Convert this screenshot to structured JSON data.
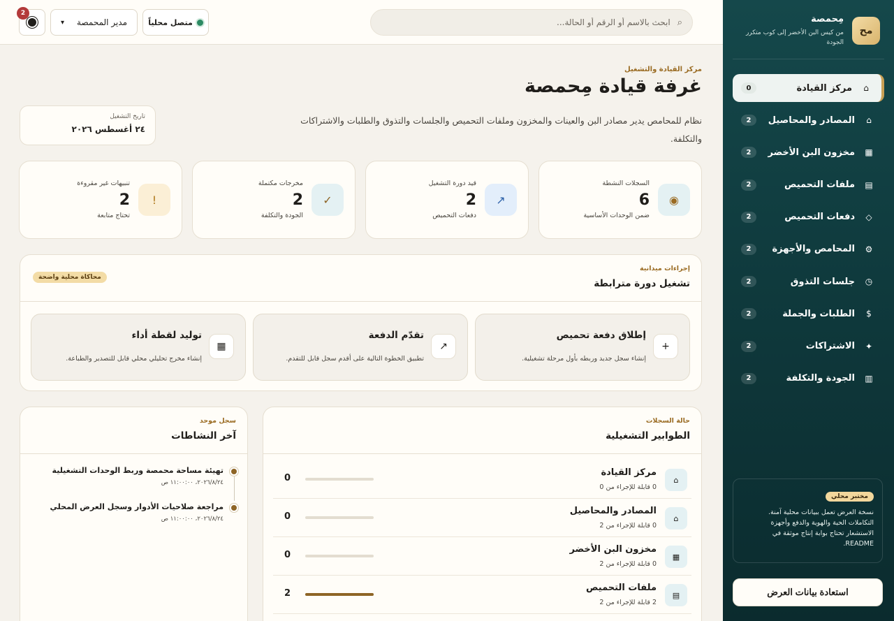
{
  "sidebar": {
    "brand": {
      "logo": "مح",
      "name": "مِحمصة",
      "subtitle": "من كيس البن الأخضر إلى كوب متكرر الجودة"
    },
    "items": [
      {
        "icon": "⌂",
        "label": "مركز القيادة",
        "count": "0",
        "active": true
      },
      {
        "icon": "⌂",
        "label": "المصادر والمحاصيل",
        "count": "2"
      },
      {
        "icon": "▦",
        "label": "مخزون البن الأخضر",
        "count": "2"
      },
      {
        "icon": "▤",
        "label": "ملفات التحميص",
        "count": "2"
      },
      {
        "icon": "◇",
        "label": "دفعات التحميص",
        "count": "2"
      },
      {
        "icon": "⚙",
        "label": "المحامص والأجهزة",
        "count": "2"
      },
      {
        "icon": "◷",
        "label": "جلسات التذوق",
        "count": "2"
      },
      {
        "icon": "$",
        "label": "الطلبات والجملة",
        "count": "2"
      },
      {
        "icon": "✦",
        "label": "الاشتراكات",
        "count": "2"
      },
      {
        "icon": "▥",
        "label": "الجودة والتكلفة",
        "count": "2"
      }
    ],
    "lab": {
      "badge": "مختبر محلي",
      "text": "نسخة العرض تعمل ببيانات محلية آمنة. التكاملات الحية والهوية والدفع وأجهزة الاستشعار تحتاج بوابة إنتاج موثقة في README."
    },
    "restore_label": "استعادة بيانات العرض"
  },
  "topbar": {
    "search_placeholder": "ابحث بالاسم أو الرقم أو الحالة...",
    "status_label": "متصل محلياً",
    "role_label": "مدير المحمصة",
    "notifications_count": "2"
  },
  "header": {
    "eyebrow": "مركز القيادة والتشغيل",
    "title": "غرفة قيادة مِحمصة",
    "description": "نظام للمحامص يدير مصادر البن والعينات والمخزون وملفات التحميص والجلسات والتذوق والطلبات والاشتراكات والتكلفة.",
    "date_label": "تاريخ التشغيل",
    "date_value": "٢٤ أغسطس ٢٠٢٦"
  },
  "stats": [
    {
      "label": "السجلات النشطة",
      "value": "6",
      "sub": "ضمن الوحدات الأساسية",
      "icon": "◉",
      "icon_bg": "#e4f1f3",
      "icon_color": "#9a6b22"
    },
    {
      "label": "قيد دورة التشغيل",
      "value": "2",
      "sub": "دفعات التحميص",
      "icon": "↗",
      "icon_bg": "#e3eefb",
      "icon_color": "#2b5fa8"
    },
    {
      "label": "مخرجات مكتملة",
      "value": "2",
      "sub": "الجودة والتكلفة",
      "icon": "✓",
      "icon_bg": "#e4f1f3",
      "icon_color": "#8e6526"
    },
    {
      "label": "تنبيهات غير مقروءة",
      "value": "2",
      "sub": "تحتاج متابعة",
      "icon": "!",
      "icon_bg": "#fbefd6",
      "icon_color": "#b07a1e"
    }
  ],
  "actions_panel": {
    "eyebrow": "إجراءات ميدانية",
    "title": "تشغيل دورة مترابطة",
    "badge": "محاكاة محلية واضحة",
    "items": [
      {
        "icon": "+",
        "title": "إطلاق دفعة تحميص",
        "desc": "إنشاء سجل جديد وربطه بأول مرحلة تشغيلية."
      },
      {
        "icon": "↗",
        "title": "تقدّم الدفعة",
        "desc": "تطبيق الخطوة التالية على أقدم سجل قابل للتقدم."
      },
      {
        "icon": "▦",
        "title": "توليد لقطة أداء",
        "desc": "إنشاء مخرج تحليلي محلي قابل للتصدير والطباعة."
      }
    ]
  },
  "queues_panel": {
    "eyebrow": "حالة السجلات",
    "title": "الطوابير التشغيلية",
    "rows": [
      {
        "icon": "⌂",
        "title": "مركز القيادة",
        "sub": "0 قابلة للإجراء من 0",
        "value": "0",
        "progress": 0
      },
      {
        "icon": "⌂",
        "title": "المصادر والمحاصيل",
        "sub": "0 قابلة للإجراء من 2",
        "value": "0",
        "progress": 0
      },
      {
        "icon": "▦",
        "title": "مخزون البن الأخضر",
        "sub": "0 قابلة للإجراء من 2",
        "value": "0",
        "progress": 0
      },
      {
        "icon": "▤",
        "title": "ملفات التحميص",
        "sub": "2 قابلة للإجراء من 2",
        "value": "2",
        "progress": 1
      }
    ]
  },
  "activity_panel": {
    "eyebrow": "سجل موحد",
    "title": "آخر النشاطات",
    "items": [
      {
        "title": "تهيئة مساحة محمصة وربط الوحدات التشغيلية",
        "time": "٢٠٢٦/٨/٢٤، ١١:٠٠:٠٠ ص"
      },
      {
        "title": "مراجعة صلاحيات الأدوار وسجل العرض المحلي",
        "time": "٢٠٢٦/٨/٢٤، ١١:٠٠:٠٠ ص"
      }
    ]
  }
}
